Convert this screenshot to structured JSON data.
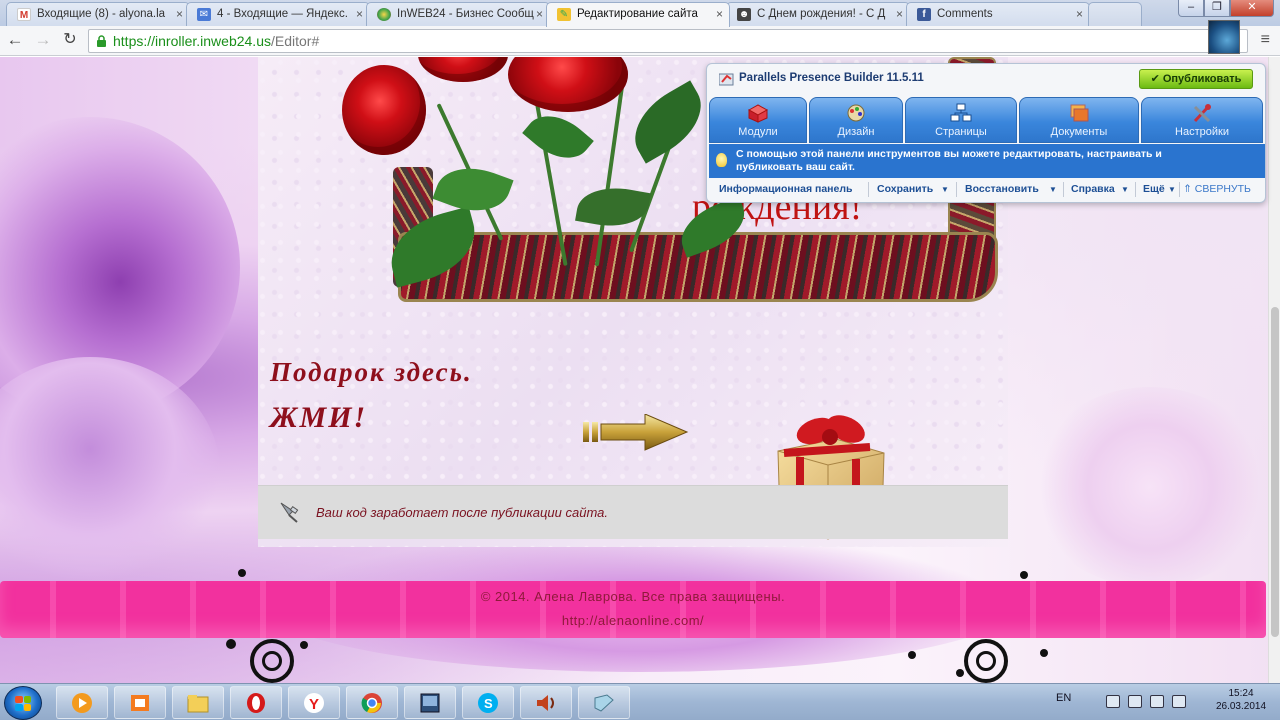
{
  "browser": {
    "tabs": [
      {
        "title": "Входящие (8) - alyona.la",
        "favicon": "gmail-icon",
        "active": false
      },
      {
        "title": "4 - Входящие — Яндекс.",
        "favicon": "yandex-mail-icon",
        "active": false
      },
      {
        "title": "InWEB24 - Бизнес Сообщ",
        "favicon": "chrome-page-icon",
        "active": false
      },
      {
        "title": "Редактирование сайта",
        "favicon": "editor-icon",
        "active": true
      },
      {
        "title": "С Днем рождения! - С Д",
        "favicon": "person-icon",
        "active": false
      },
      {
        "title": "Comments",
        "favicon": "facebook-icon",
        "active": false
      }
    ],
    "url_host": "https://inroller.inweb24.us",
    "url_path": "/Editor#"
  },
  "site": {
    "frame_text": "рождения!",
    "gift_line1": "Подарок здесь.",
    "gift_line2": "ЖМИ!",
    "notice": "Ваш код заработает после публикации сайта.",
    "footer_copyright": "© 2014. Алена Лаврова. Все права защищены.",
    "footer_link": "http://alenaonline.com/"
  },
  "builder": {
    "title": "Parallels Presence Builder 11.5.11",
    "publish_label": "Опубликовать",
    "tabs": [
      {
        "label": "Модули",
        "icon": "modules-icon"
      },
      {
        "label": "Дизайн",
        "icon": "design-icon"
      },
      {
        "label": "Страницы",
        "icon": "pages-icon"
      },
      {
        "label": "Документы",
        "icon": "documents-icon"
      },
      {
        "label": "Настройки",
        "icon": "settings-icon"
      }
    ],
    "info_text": "С помощью этой панели инструментов вы можете редактировать, настраивать и публиковать ваш сайт.",
    "menu": {
      "dashboard": "Информационная панель",
      "save": "Сохранить",
      "restore": "Восстановить",
      "help": "Справка",
      "more": "Ещё",
      "collapse": "СВЕРНУТЬ"
    }
  },
  "taskbar": {
    "apps": [
      "media-player-icon",
      "app-icon",
      "explorer-icon",
      "opera-icon",
      "yandex-browser-icon",
      "chrome-icon",
      "app-window-icon",
      "skype-icon",
      "audio-icon",
      "files-icon"
    ],
    "lang": "EN",
    "time": "15:24",
    "date": "26.03.2014"
  },
  "colors": {
    "accent_blue": "#2a74cf",
    "publish_green": "#6cba13",
    "footer_pink": "#f2319e",
    "text_maroon": "#8e0f1c"
  }
}
